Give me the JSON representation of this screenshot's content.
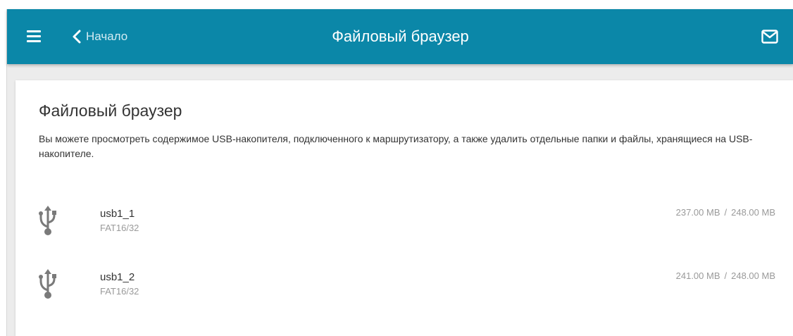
{
  "header": {
    "back_label": "Начало",
    "title": "Файловый браузер",
    "menu_icon": "hamburger-menu-icon",
    "back_icon": "chevron-left-icon",
    "notifications_icon": "mail-icon",
    "bar_color": "#0b87a8"
  },
  "page": {
    "heading": "Файловый браузер",
    "description": "Вы можете просмотреть содержимое USB-накопителя, подключенного к маршрутизатору, а также удалить отдельные папки и файлы, хранящиеся на USB-накопителе."
  },
  "devices": [
    {
      "name": "usb1_1",
      "filesystem": "FAT16/32",
      "used": "237.00 MB",
      "total": "248.00 MB",
      "separator": "/",
      "icon": "usb-icon"
    },
    {
      "name": "usb1_2",
      "filesystem": "FAT16/32",
      "used": "241.00 MB",
      "total": "248.00 MB",
      "separator": "/",
      "icon": "usb-icon"
    }
  ]
}
